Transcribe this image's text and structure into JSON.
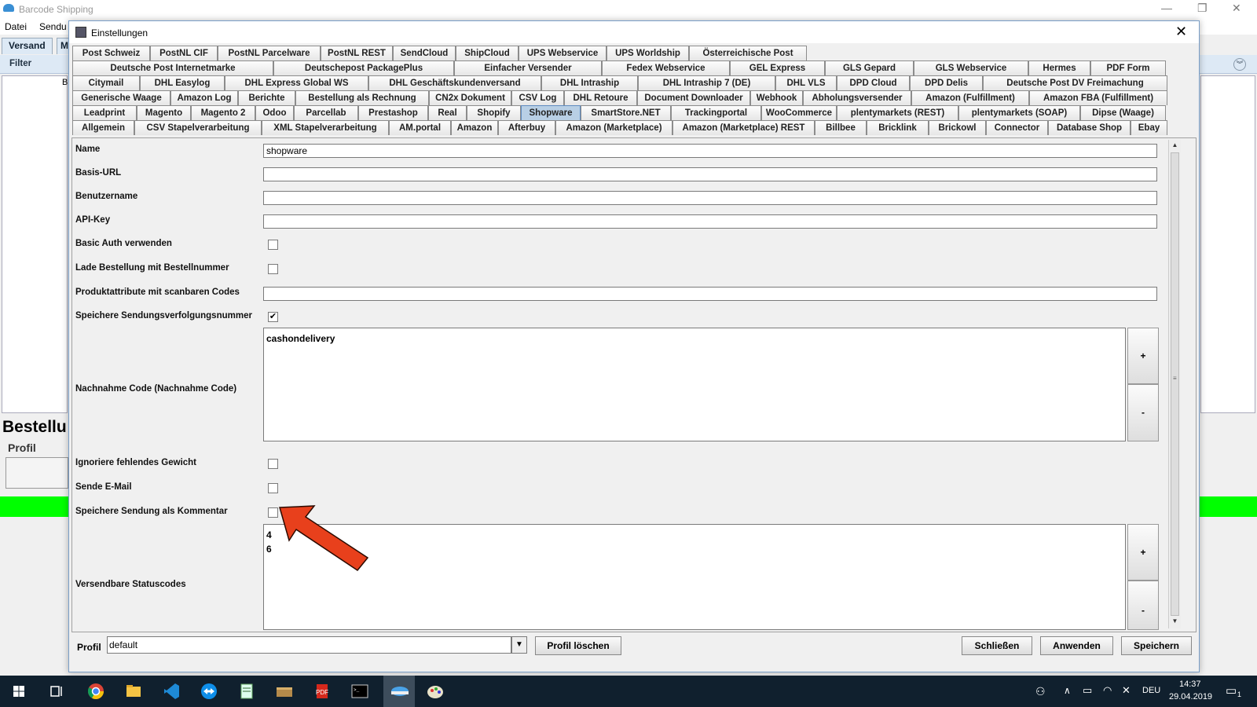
{
  "background_app": {
    "window_title": "Barcode Shipping",
    "menu": [
      "Datei",
      "Sendu"
    ],
    "tabs": [
      "Versand",
      "M"
    ],
    "filter_label": "Filter",
    "list_header": "B",
    "order_heading": "Bestellu",
    "profile_label": "Profil"
  },
  "dialog": {
    "title": "Einstellungen",
    "tab_rows": [
      [
        "Post Schweiz",
        "PostNL CIF",
        "PostNL Parcelware",
        "PostNL REST",
        "SendCloud",
        "ShipCloud",
        "UPS Webservice",
        "UPS Worldship",
        "Österreichische Post"
      ],
      [
        "Deutsche Post Internetmarke",
        "Deutschepost PackagePlus",
        "Einfacher Versender",
        "Fedex Webservice",
        "GEL Express",
        "GLS Gepard",
        "GLS Webservice",
        "Hermes",
        "PDF Form"
      ],
      [
        "Citymail",
        "DHL Easylog",
        "DHL Express Global WS",
        "DHL Geschäftskundenversand",
        "DHL Intraship",
        "DHL Intraship 7 (DE)",
        "DHL VLS",
        "DPD Cloud",
        "DPD Delis",
        "Deutsche Post DV Freimachung"
      ],
      [
        "Generische Waage",
        "Amazon Log",
        "Berichte",
        "Bestellung als Rechnung",
        "CN2x Dokument",
        "CSV Log",
        "DHL Retoure",
        "Document Downloader",
        "Webhook",
        "Abholungsversender",
        "Amazon (Fulfillment)",
        "Amazon FBA (Fulfillment)"
      ],
      [
        "Leadprint",
        "Magento",
        "Magento 2",
        "Odoo",
        "Parcellab",
        "Prestashop",
        "Real",
        "Shopify",
        "Shopware",
        "SmartStore.NET",
        "Trackingportal",
        "WooCommerce",
        "plentymarkets (REST)",
        "plentymarkets (SOAP)",
        "Dipse (Waage)"
      ],
      [
        "Allgemein",
        "CSV Stapelverarbeitung",
        "XML Stapelverarbeitung",
        "AM.portal",
        "Amazon",
        "Afterbuy",
        "Amazon (Marketplace)",
        "Amazon (Marketplace) REST",
        "Billbee",
        "Bricklink",
        "Brickowl",
        "Connector",
        "Database Shop",
        "Ebay"
      ]
    ],
    "selected_tab": "Shopware",
    "fields": {
      "name_label": "Name",
      "name_value": "shopware",
      "url_label": "Basis-URL",
      "url_value": "",
      "user_label": "Benutzername",
      "user_value": "",
      "apikey_label": "API-Key",
      "apikey_value": "",
      "basic_auth_label": "Basic Auth verwenden",
      "basic_auth_checked": false,
      "load_order_label": "Lade Bestellung mit Bestellnummer",
      "load_order_checked": false,
      "product_attr_label": "Produktattribute mit scanbaren Codes",
      "product_attr_value": "",
      "save_tracking_label": "Speichere Sendungsverfolgungsnummer",
      "save_tracking_checked": true,
      "cod_label": "Nachnahme Code (Nachnahme Code)",
      "cod_values": "cashondelivery",
      "ignore_weight_label": "Ignoriere fehlendes Gewicht",
      "ignore_weight_checked": false,
      "send_email_label": "Sende E-Mail",
      "send_email_checked": false,
      "save_comment_label": "Speichere Sendung als Kommentar",
      "save_comment_checked": false,
      "status_label": "Versendbare Statuscodes",
      "status_values": "4\n6",
      "add_label": "+",
      "remove_label": "-"
    },
    "footer": {
      "profile_label": "Profil",
      "profile_value": "default",
      "delete_profile": "Profil löschen",
      "close": "Schließen",
      "apply": "Anwenden",
      "save": "Speichern"
    }
  },
  "taskbar": {
    "time": "14:37",
    "date": "29.04.2019",
    "lang": "DEU",
    "notification_count": "1"
  },
  "colors": {
    "annotation_arrow": "#e8401c",
    "selected_tab": "#b8cfe5",
    "status_green": "#00ff00"
  }
}
